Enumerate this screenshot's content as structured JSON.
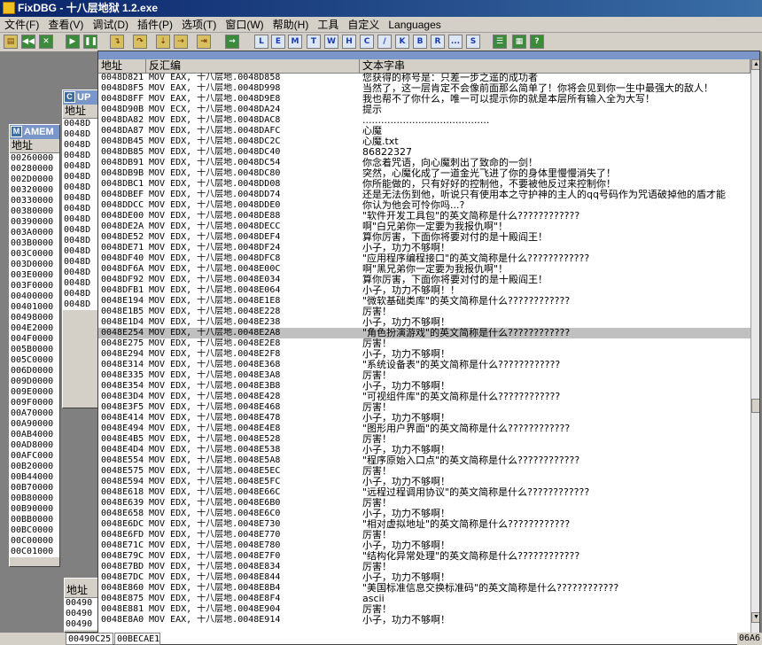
{
  "title": "FixDBG - 十八层地狱 1.2.exe",
  "menu": [
    "文件(F)",
    "查看(V)",
    "调试(D)",
    "插件(P)",
    "选项(T)",
    "窗口(W)",
    "帮助(H)",
    "工具",
    "自定义",
    "Languages"
  ],
  "toolbar_letters": [
    "L",
    "E",
    "M",
    "T",
    "W",
    "H",
    "C",
    "/",
    "K",
    "B",
    "R",
    "...",
    "S"
  ],
  "bg_windows": {
    "m_title": "AMEM",
    "m_head": "地址",
    "m_addresses": [
      "00260000",
      "00280000",
      "002D0000",
      "00320000",
      "00330000",
      "00380000",
      "00390000",
      "003A0000",
      "003B0000",
      "003C0000",
      "003D0000",
      "003E0000",
      "003F0000",
      "00400000",
      "00401000",
      "00498000",
      "004E2000",
      "004F0000",
      "005B0000",
      "005C0000",
      "006D0000",
      "009D0000",
      "009E0000",
      "009F0000",
      "00A70000",
      "00A90000",
      "00AB4000",
      "00AD8000",
      "00AFC000",
      "00B20000",
      "00B44000",
      "00B70000",
      "00B80000",
      "00B90000",
      "00BB0000",
      "00BC0000",
      "00C00000",
      "00C01000"
    ],
    "c_title": "UP",
    "c_head": "地址",
    "c_addresses": [
      "0048D",
      "0048D",
      "0048D",
      "0048D",
      "0048D",
      "0048D",
      "0048D",
      "0048D",
      "0048D",
      "0048D",
      "0048D",
      "0048D",
      "0048D",
      "0048D",
      "0048D",
      "0048D",
      "0048D",
      "0048D"
    ],
    "bottom_head": "地址",
    "bottom_addresses": [
      "00490",
      "00490",
      "00490"
    ]
  },
  "main": {
    "title": "文本字串",
    "col_address": "地址",
    "col_disasm": "反汇编",
    "col_text": "文本字串",
    "selected_index": 24,
    "rows": [
      {
        "a": "0048D821",
        "d": "MOV EAX, 十八层地.0048D858",
        "t": "您获得的称号是：只差一步之遥的成功者"
      },
      {
        "a": "0048D8F5",
        "d": "MOV EAX, 十八层地.0048D998",
        "t": "当然了，这一层肯定不会像前面那么简单了！你将会见到你一生中最强大的敌人！"
      },
      {
        "a": "0048D8FF",
        "d": "MOV EAX, 十八层地.0048D9E8",
        "t": "我也帮不了你什么，唯一可以提示你的就是本层所有输入全为大写！"
      },
      {
        "a": "0048D90B",
        "d": "MOV ECX, 十八层地.0048DA24",
        "t": "提示"
      },
      {
        "a": "0048DA82",
        "d": "MOV EDX, 十八层地.0048DAC8",
        "t": "........................................."
      },
      {
        "a": "0048DA87",
        "d": "MOV EDX, 十八层地.0048DAFC",
        "t": "心魔"
      },
      {
        "a": "0048DB45",
        "d": "MOV EDX, 十八层地.0048DC2C",
        "t": "心魔.txt"
      },
      {
        "a": "0048DB85",
        "d": "MOV EDX, 十八层地.0048DC40",
        "t": "86822327"
      },
      {
        "a": "0048DB91",
        "d": "MOV EDX, 十八层地.0048DC54",
        "t": "你念着咒语，向心魔刺出了致命的一剑！"
      },
      {
        "a": "0048DB9B",
        "d": "MOV EDX, 十八层地.0048DC80",
        "t": "突然，心魔化成了一道金光飞进了你的身体里慢慢消失了！"
      },
      {
        "a": "0048DBC1",
        "d": "MOV EDX, 十八层地.0048DD08",
        "t": "你所能做的，只有好好的控制他，不要被他反过来控制你！"
      },
      {
        "a": "0048DBEF",
        "d": "MOV EDX, 十八层地.0048DD74",
        "t": "还是无法伤到他，听说只有使用本之守护神的主人的qq号码作为咒语破掉他的盾才能"
      },
      {
        "a": "0048DDCC",
        "d": "MOV EDX, 十八层地.0048DDE0",
        "t": "你认为他会可怜你吗...?"
      },
      {
        "a": "0048DE00",
        "d": "MOV EDX, 十八层地.0048DE88",
        "t": "\"软件开发工具包\"的英文简称是什么????????????"
      },
      {
        "a": "0048DE2A",
        "d": "MOV EDX, 十八层地.0048DECC",
        "t": "啊\"白兄弟你一定要为我报仇啊\"！"
      },
      {
        "a": "0048DE52",
        "d": "MOV EDX, 十八层地.0048DEF4",
        "t": "算你厉害，下面你将要对付的是十殿阎王！"
      },
      {
        "a": "0048DE71",
        "d": "MOV EDX, 十八层地.0048DF24",
        "t": "小子，功力不够啊！"
      },
      {
        "a": "0048DF40",
        "d": "MOV EDX, 十八层地.0048DFC8",
        "t": "\"应用程序编程接口\"的英文简称是什么????????????"
      },
      {
        "a": "0048DF6A",
        "d": "MOV EDX, 十八层地.0048E00C",
        "t": "啊\"黑兄弟你一定要为我报仇啊\"！"
      },
      {
        "a": "0048DF92",
        "d": "MOV EDX, 十八层地.0048E034",
        "t": "算你厉害，下面你将要对付的是十殿阎王！"
      },
      {
        "a": "0048DFB1",
        "d": "MOV EDX, 十八层地.0048E064",
        "t": "小子，功力不够啊！！"
      },
      {
        "a": "0048E194",
        "d": "MOV EDX, 十八层地.0048E1E8",
        "t": "\"微软基础类库\"的英文简称是什么????????????"
      },
      {
        "a": "0048E1B5",
        "d": "MOV EDX, 十八层地.0048E228",
        "t": "厉害！"
      },
      {
        "a": "0048E1D4",
        "d": "MOV EDX, 十八层地.0048E238",
        "t": "小子，功力不够啊！"
      },
      {
        "a": "0048E254",
        "d": "MOV EDX, 十八层地.0048E2A8",
        "t": "\"角色扮演游戏\"的英文简称是什么????????????"
      },
      {
        "a": "0048E275",
        "d": "MOV EDX, 十八层地.0048E2E8",
        "t": "厉害！"
      },
      {
        "a": "0048E294",
        "d": "MOV EDX, 十八层地.0048E2F8",
        "t": "小子，功力不够啊！"
      },
      {
        "a": "0048E314",
        "d": "MOV EDX, 十八层地.0048E368",
        "t": "\"系统设备表\"的英文简称是什么????????????"
      },
      {
        "a": "0048E335",
        "d": "MOV EDX, 十八层地.0048E3A8",
        "t": "厉害！"
      },
      {
        "a": "0048E354",
        "d": "MOV EDX, 十八层地.0048E3B8",
        "t": "小子，功力不够啊！"
      },
      {
        "a": "0048E3D4",
        "d": "MOV EDX, 十八层地.0048E428",
        "t": "\"可视组件库\"的英文简称是什么????????????"
      },
      {
        "a": "0048E3F5",
        "d": "MOV EDX, 十八层地.0048E468",
        "t": "厉害！"
      },
      {
        "a": "0048E414",
        "d": "MOV EDX, 十八层地.0048E478",
        "t": "小子，功力不够啊！"
      },
      {
        "a": "0048E494",
        "d": "MOV EDX, 十八层地.0048E4E8",
        "t": "\"图形用户界面\"的英文简称是什么????????????"
      },
      {
        "a": "0048E4B5",
        "d": "MOV EDX, 十八层地.0048E528",
        "t": "厉害！"
      },
      {
        "a": "0048E4D4",
        "d": "MOV EDX, 十八层地.0048E538",
        "t": "小子，功力不够啊！"
      },
      {
        "a": "0048E554",
        "d": "MOV EDX, 十八层地.0048E5A8",
        "t": "\"程序原始入口点\"的英文简称是什么????????????"
      },
      {
        "a": "0048E575",
        "d": "MOV EDX, 十八层地.0048E5EC",
        "t": "厉害！"
      },
      {
        "a": "0048E594",
        "d": "MOV EDX, 十八层地.0048E5FC",
        "t": "小子，功力不够啊！"
      },
      {
        "a": "0048E618",
        "d": "MOV EDX, 十八层地.0048E66C",
        "t": "\"远程过程调用协议\"的英文简称是什么????????????"
      },
      {
        "a": "0048E639",
        "d": "MOV EDX, 十八层地.0048E6B0",
        "t": "厉害！"
      },
      {
        "a": "0048E658",
        "d": "MOV EDX, 十八层地.0048E6C0",
        "t": "小子，功力不够啊！"
      },
      {
        "a": "0048E6DC",
        "d": "MOV EDX, 十八层地.0048E730",
        "t": "\"相对虚拟地址\"的英文简称是什么????????????"
      },
      {
        "a": "0048E6FD",
        "d": "MOV EDX, 十八层地.0048E770",
        "t": "厉害！"
      },
      {
        "a": "0048E71C",
        "d": "MOV EDX, 十八层地.0048E780",
        "t": "小子，功力不够啊！"
      },
      {
        "a": "0048E79C",
        "d": "MOV EDX, 十八层地.0048E7F0",
        "t": "\"结构化异常处理\"的英文简称是什么????????????"
      },
      {
        "a": "0048E7BD",
        "d": "MOV EDX, 十八层地.0048E834",
        "t": "厉害！"
      },
      {
        "a": "0048E7DC",
        "d": "MOV EDX, 十八层地.0048E844",
        "t": "小子，功力不够啊！"
      },
      {
        "a": "0048E860",
        "d": "MOV EDX, 十八层地.0048E8B4",
        "t": "\"美国标准信息交换标准码\"的英文简称是什么????????????"
      },
      {
        "a": "0048E875",
        "d": "MOV EDX, 十八层地.0048E8F4",
        "t": "ascii"
      },
      {
        "a": "0048E881",
        "d": "MOV EDX, 十八层地.0048E904",
        "t": "厉害！"
      },
      {
        "a": "0048E8A0",
        "d": "MOV EAX, 十八层地.0048E914",
        "t": "小子，功力不够啊！"
      }
    ]
  },
  "status": {
    "left_address": "00490C25",
    "left_value": "00BECAE1",
    "right_value": "06A6"
  }
}
